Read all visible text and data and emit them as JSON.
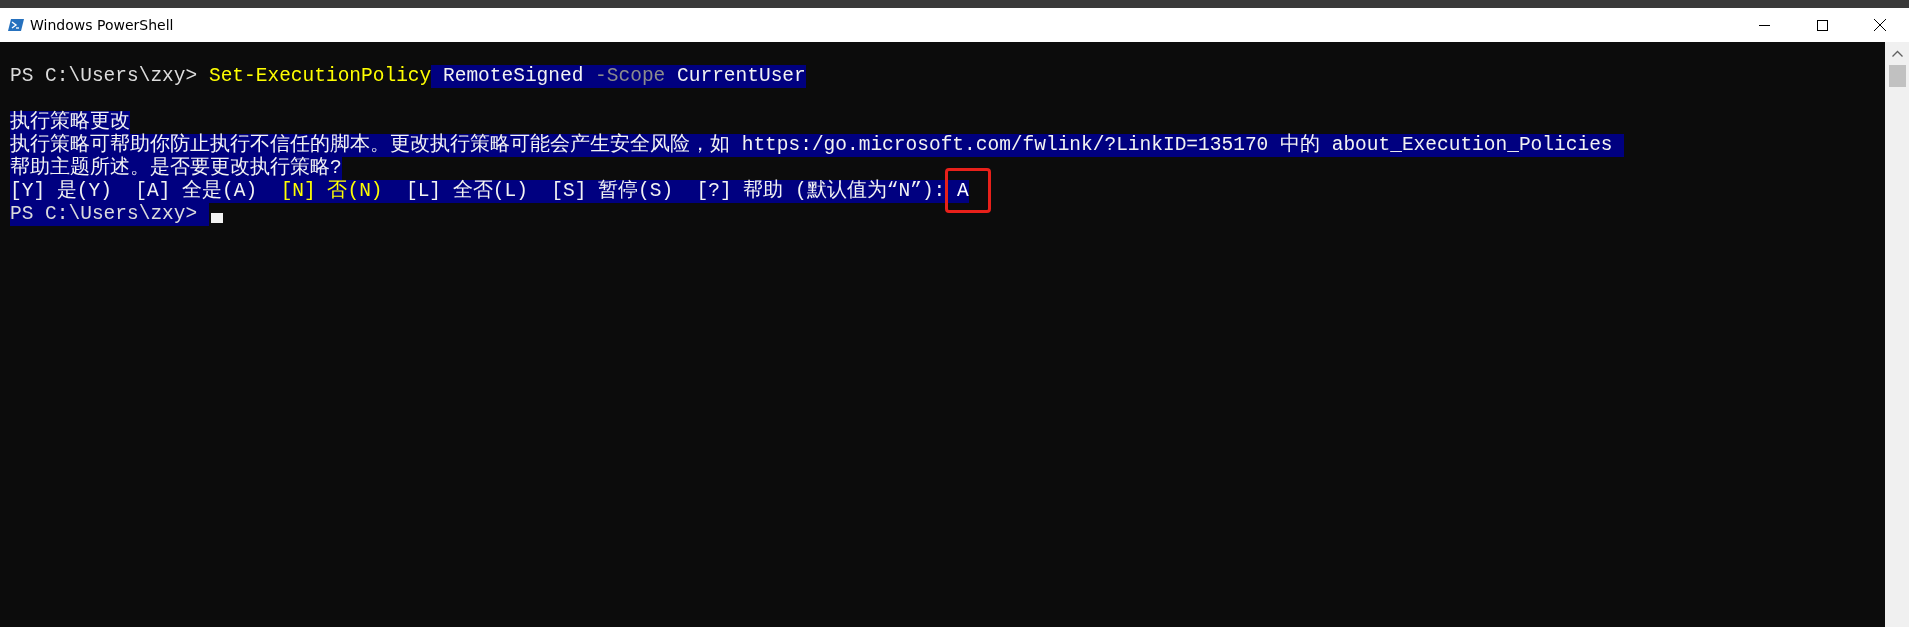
{
  "window": {
    "title": "Windows PowerShell"
  },
  "console": {
    "lines": [
      {
        "kind": "text",
        "segments": [
          {
            "text": "PS C:\\Users\\zxy> ",
            "kind": "prompt",
            "highlighted": false
          },
          {
            "text": "Set-ExecutionPolicy",
            "kind": "command",
            "highlighted": false
          },
          {
            "text": " RemoteSigned ",
            "kind": "argument",
            "highlighted": true
          },
          {
            "text": "-Scope",
            "kind": "parameter",
            "highlighted": true
          },
          {
            "text": " CurrentUser",
            "kind": "argument",
            "highlighted": true
          }
        ]
      },
      {
        "kind": "blank"
      },
      {
        "kind": "text",
        "segments": [
          {
            "text": "执行策略更改",
            "kind": "output",
            "highlighted": true
          }
        ]
      },
      {
        "kind": "text",
        "segments": [
          {
            "text": "执行策略可帮助你防止执行不信任的脚本。更改执行策略可能会产生安全风险，如 https:/go.microsoft.com/fwlink/?LinkID=135170 中的 about_Execution_Policies ",
            "kind": "output",
            "highlighted": true
          }
        ]
      },
      {
        "kind": "text",
        "segments": [
          {
            "text": "帮助主题所述。是否要更改执行策略?",
            "kind": "output",
            "highlighted": true
          }
        ]
      },
      {
        "kind": "text",
        "segments": [
          {
            "text": "[Y] 是(Y)  [A] 全是(A)  ",
            "kind": "output",
            "highlighted": true
          },
          {
            "text": "[N] 否(N)",
            "kind": "warning",
            "highlighted": true
          },
          {
            "text": "  [L] 全否(L)  [S] 暂停(S)  [?] 帮助 (默认值为“N”): ",
            "kind": "output",
            "highlighted": true
          },
          {
            "text": "A",
            "kind": "input",
            "highlighted": true,
            "annotated": true
          }
        ]
      },
      {
        "kind": "text",
        "cursor": true,
        "segments": [
          {
            "text": "PS C:\\Users\\zxy> ",
            "kind": "prompt",
            "highlighted": true
          }
        ]
      }
    ]
  }
}
